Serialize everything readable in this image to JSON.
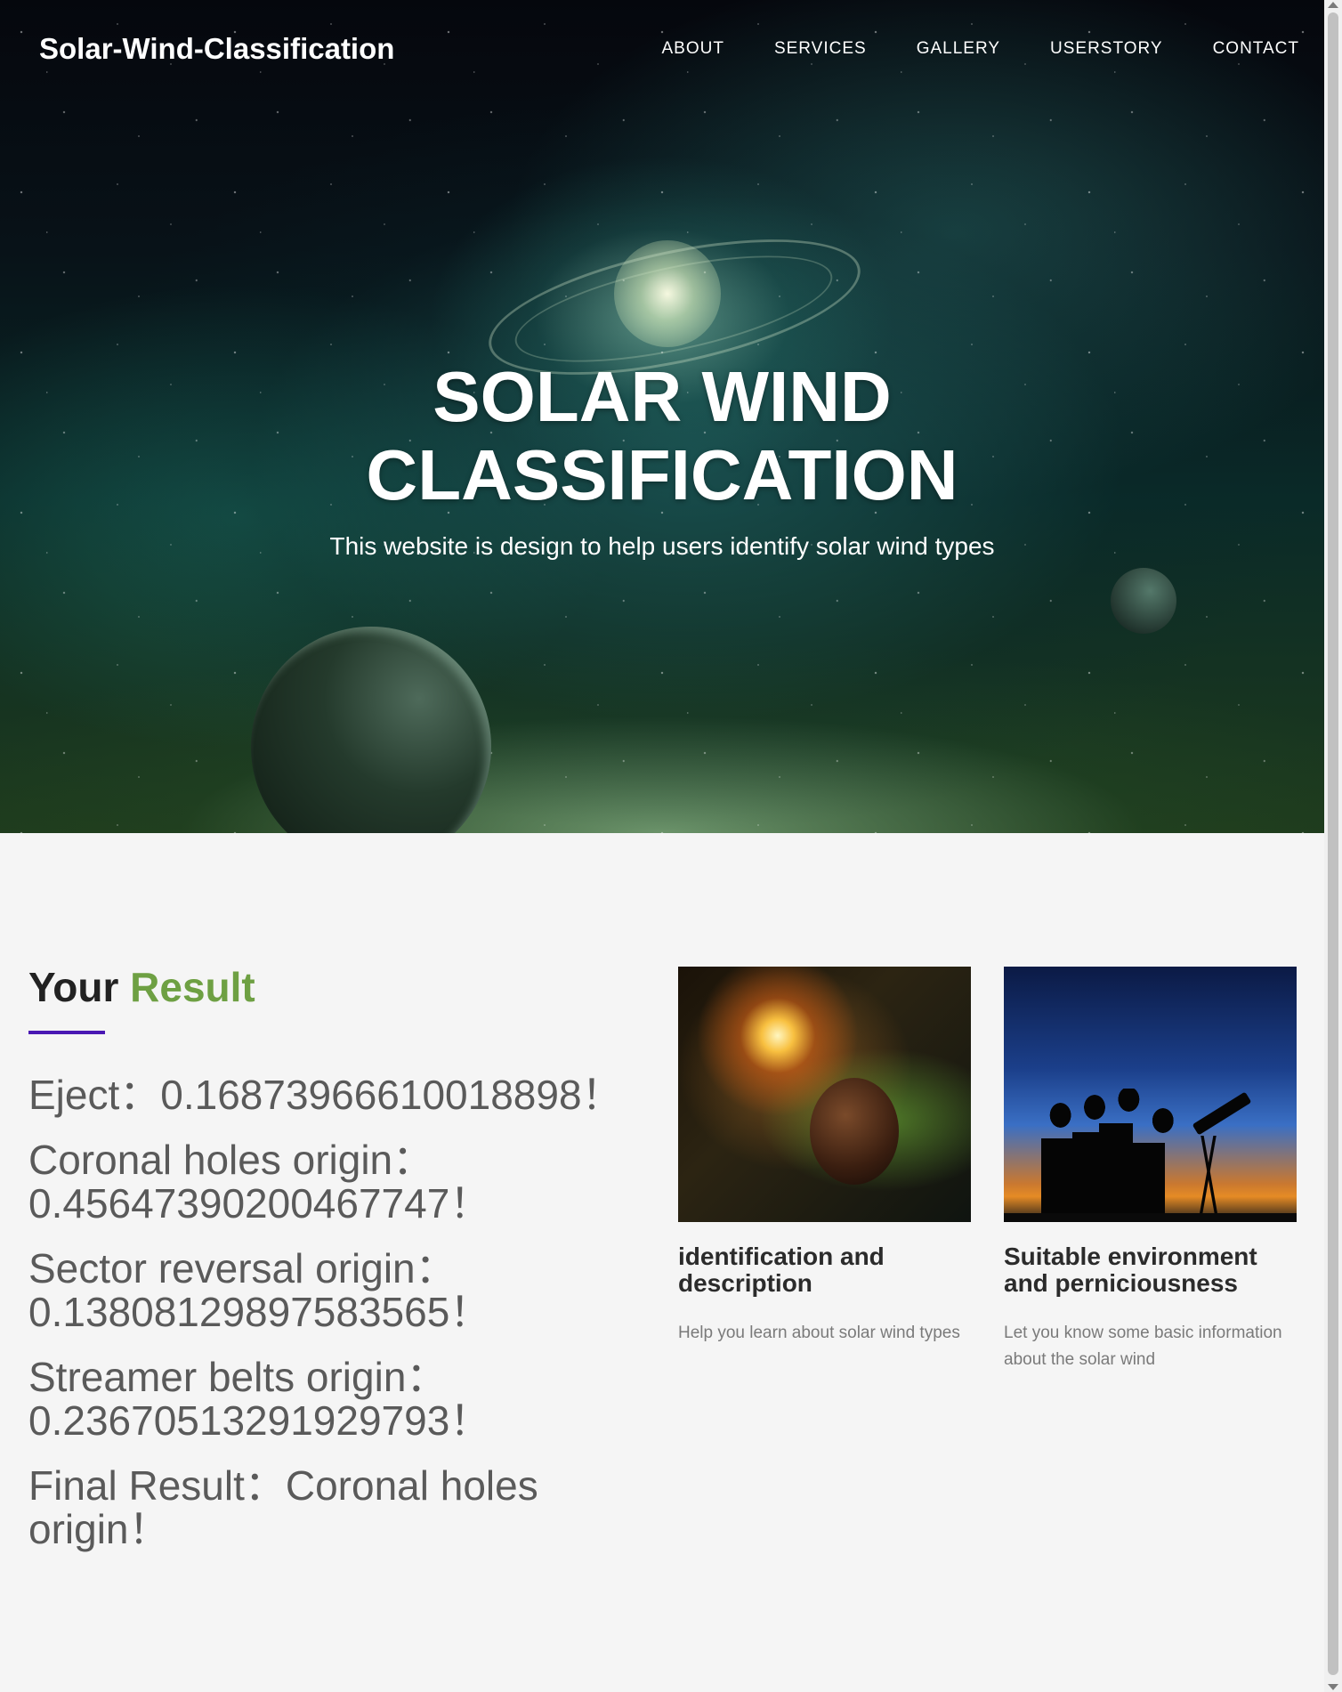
{
  "navbar": {
    "brand": "Solar-Wind-Classification",
    "links": [
      "ABOUT",
      "SERVICES",
      "GALLERY",
      "USERSTORY",
      "CONTACT"
    ]
  },
  "hero": {
    "title_line1": "SOLAR WIND",
    "title_line2": "CLASSIFICATION",
    "subtitle": "This website is design to help users identify solar wind types"
  },
  "result": {
    "heading_prefix": "Your",
    "heading_accent": "Result",
    "lines": [
      "Eject：0.16873966610018898！",
      "Coronal holes origin：0.45647390200467747！",
      "Sector reversal origin：0.13808129897583565！",
      "Streamer belts origin：0.23670513291929793！",
      "Final Result：Coronal holes origin！"
    ]
  },
  "cards": [
    {
      "title": "identification and description",
      "text": "Help you learn about solar wind types"
    },
    {
      "title": "Suitable environment and perniciousness",
      "text": "Let you know some basic information about the solar wind"
    }
  ],
  "colors": {
    "accent_green": "#6ea043",
    "underline_purple": "#4a17b3",
    "page_background": "#f5f5f5"
  }
}
